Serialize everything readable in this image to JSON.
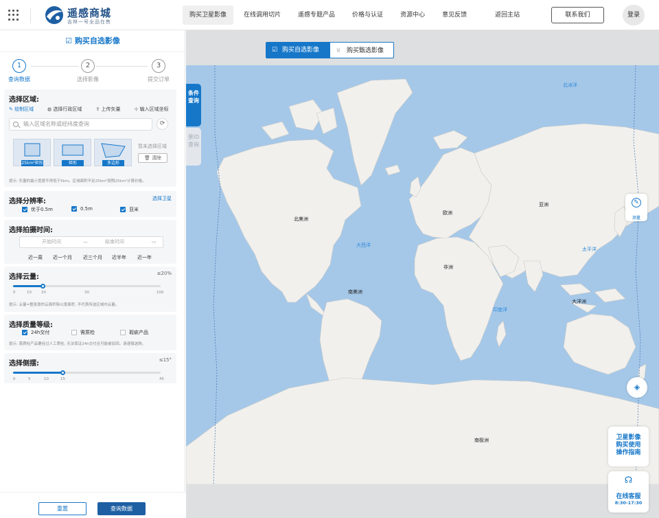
{
  "header": {
    "brand": "遥感商城",
    "brand_sub": "吉林一号全品在售",
    "nav": [
      "购买卫星影像",
      "在线调用切片",
      "遥感专题产品",
      "价格与认证",
      "资源中心",
      "意见反馈",
      "返回主站"
    ],
    "contact": "联系我们",
    "login": "登录"
  },
  "sidebar": {
    "title": "购买自选影像",
    "steps": [
      {
        "num": "1",
        "label": "查询数据"
      },
      {
        "num": "2",
        "label": "选择影像"
      },
      {
        "num": "3",
        "label": "提交订单"
      }
    ],
    "area": {
      "title": "选择区域:",
      "tabs": [
        "绘制区域",
        "选择行政区域",
        "上传矢量",
        "输入区域坐标"
      ],
      "search_placeholder": "输入区域名称或经纬度查询",
      "shapes": [
        "25km²矩形",
        "矩形",
        "多边形"
      ],
      "no_area": "暂未选择区域",
      "clear": "清除",
      "hint": "提示: 矢量的最小宽度不得低于5km。区域面积不足25km²按照25km²计算价格。"
    },
    "resolution": {
      "title": "选择分辨率:",
      "link": "选择卫星",
      "options": [
        "优于0.5m",
        "0.5m",
        "亚米"
      ]
    },
    "time": {
      "title": "选择拍摄时间:",
      "start_placeholder": "开始时间",
      "dash": "—",
      "end_placeholder": "结束时间",
      "quick": [
        "近一周",
        "近一个月",
        "近三个月",
        "近半年",
        "近一年"
      ]
    },
    "cloud": {
      "title": "选择云量:",
      "value": "≤20%",
      "ticks": [
        "0",
        "10",
        "20",
        "30",
        "100"
      ],
      "hint": "提示: 云量=整张景的云面积除以景面积, 不代表所选区域内云量。"
    },
    "quality": {
      "title": "选择质量等级:",
      "options": [
        "24h交付",
        "需质检",
        "瑕疵产品"
      ],
      "hint": "提示: 需质检产品要经过人工质检, 无法保证24h交付且可能被驳回。请谨慎选购。"
    },
    "tilt": {
      "title": "选择侧摆:",
      "value": "≤15°",
      "ticks": [
        "0",
        "5",
        "10",
        "15",
        "45"
      ]
    },
    "reset": "重置",
    "query": "查询数据"
  },
  "map": {
    "tab_custom": "购买自选影像",
    "tab_curated": "购买甄选影像",
    "side_tab_condition": "条件查询",
    "side_tab_id": "景ID查询",
    "continents": [
      "北美洲",
      "欧洲",
      "亚洲",
      "非洲",
      "南美洲",
      "大洋洲",
      "南极洲"
    ],
    "oceans": [
      "北冰洋",
      "大西洋",
      "太平洋",
      "印度洋"
    ],
    "measure": "测量",
    "guide": "卫星影像购买使用操作指南",
    "service": "在线客服",
    "service_time": "8:30-17:30"
  }
}
